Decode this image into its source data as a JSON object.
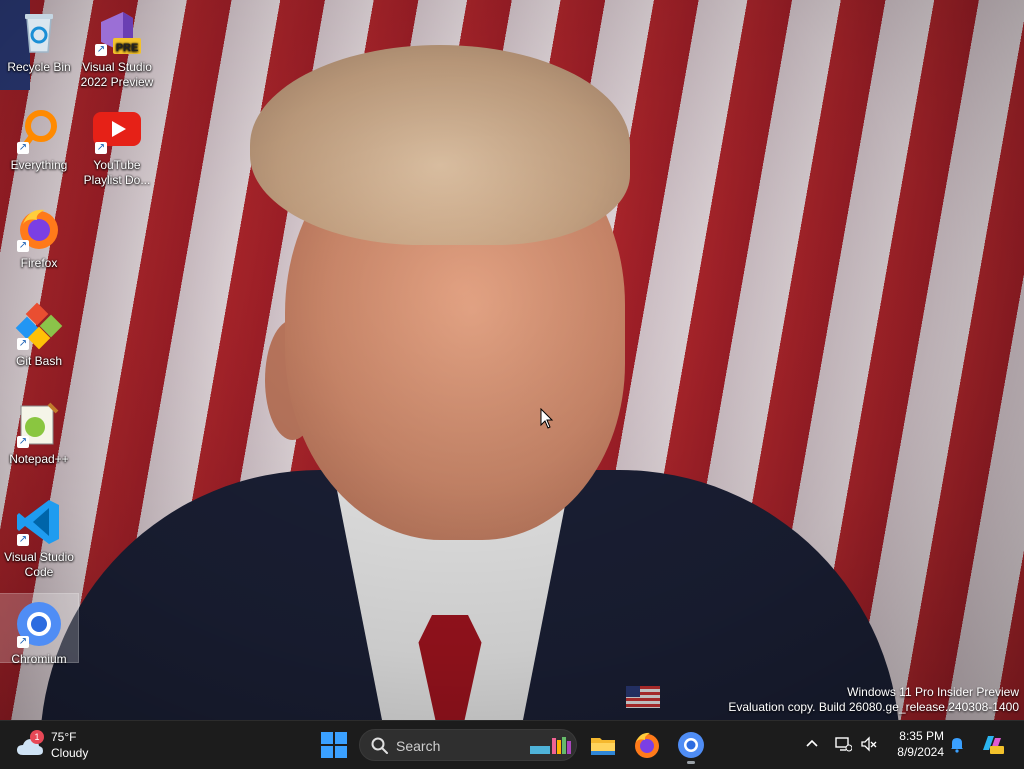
{
  "desktop": {
    "icons": [
      {
        "label": "Recycle Bin",
        "icon": "recycle-bin-icon"
      },
      {
        "label": "Visual Studio 2022 Preview",
        "icon": "visual-studio-preview-icon",
        "badge": "PRE"
      },
      {
        "label": "Everything",
        "icon": "everything-search-icon"
      },
      {
        "label": "YouTube Playlist Do...",
        "icon": "youtube-icon"
      },
      {
        "label": "Firefox",
        "icon": "firefox-icon"
      },
      {
        "label": "Git Bash",
        "icon": "git-bash-icon"
      },
      {
        "label": "Notepad++",
        "icon": "notepad-plus-plus-icon"
      },
      {
        "label": "Visual Studio Code",
        "icon": "vscode-icon"
      },
      {
        "label": "Chromium",
        "icon": "chromium-icon",
        "selected": true
      }
    ],
    "watermark": {
      "line1": "Windows 11 Pro Insider Preview",
      "line2": "Evaluation copy. Build 26080.ge_release.240308-1400"
    }
  },
  "taskbar": {
    "weather": {
      "temp": "75°F",
      "condition": "Cloudy",
      "badge": "1"
    },
    "search": {
      "placeholder": "Search"
    },
    "apps": [
      "file-explorer-icon",
      "firefox-icon",
      "chromium-icon"
    ],
    "clock": {
      "time": "8:35 PM",
      "date": "8/9/2024"
    }
  },
  "colors": {
    "taskbar_bg": "#1c1c1c",
    "accent": "#0078d4"
  }
}
